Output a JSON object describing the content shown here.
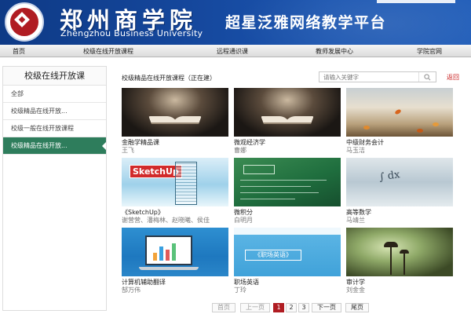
{
  "header": {
    "school_name": "郑州商学院",
    "school_name_en": "Zhengzhou Business University",
    "platform_title": "超星泛雅网络教学平台",
    "logo_icon": "school-seal-icon"
  },
  "nav": {
    "items": [
      {
        "label": "首页"
      },
      {
        "label": "校级在线开放课程"
      },
      {
        "label": "远程通识课"
      },
      {
        "label": "教师发展中心"
      },
      {
        "label": "学院官网"
      }
    ]
  },
  "sidebar": {
    "title": "校级在线开放课",
    "items": [
      {
        "label": "全部",
        "active": false
      },
      {
        "label": "校级精品在线开放...",
        "active": false
      },
      {
        "label": "校级一般在线开放课程",
        "active": false
      },
      {
        "label": "校级精品在线开放...",
        "active": true
      }
    ]
  },
  "main": {
    "heading": "校级精品在线开放课程（正在建）",
    "search": {
      "placeholder": "请输入关键字",
      "value": ""
    },
    "back_label": "返回",
    "courses": [
      {
        "name": "金融学精品课",
        "teacher": "王飞"
      },
      {
        "name": "微观经济学",
        "teacher": "曹娜"
      },
      {
        "name": "中级财务会计",
        "teacher": "马玉洁"
      },
      {
        "name": "《SketchUp》",
        "teacher": "谢营营、潘梅林、赵晓曦、侯佳",
        "thumb_text": "SketchUp"
      },
      {
        "name": "微积分",
        "teacher": "白明月"
      },
      {
        "name": "高等数学",
        "teacher": "马靖兰"
      },
      {
        "name": "计算机辅助翻译",
        "teacher": "郜万伟"
      },
      {
        "name": "职场英语",
        "teacher": "丁玲",
        "thumb_text": "《职场英语》"
      },
      {
        "name": "审计学",
        "teacher": "刘金金"
      }
    ]
  },
  "pagination": {
    "first": "首页",
    "prev": "上一页",
    "pages": [
      "1",
      "2",
      "3"
    ],
    "current": "1",
    "next": "下一页",
    "last": "尾页"
  },
  "colors": {
    "header_blue": "#15479c",
    "active_green": "#2e7d5c",
    "accent_red": "#b01c22"
  }
}
